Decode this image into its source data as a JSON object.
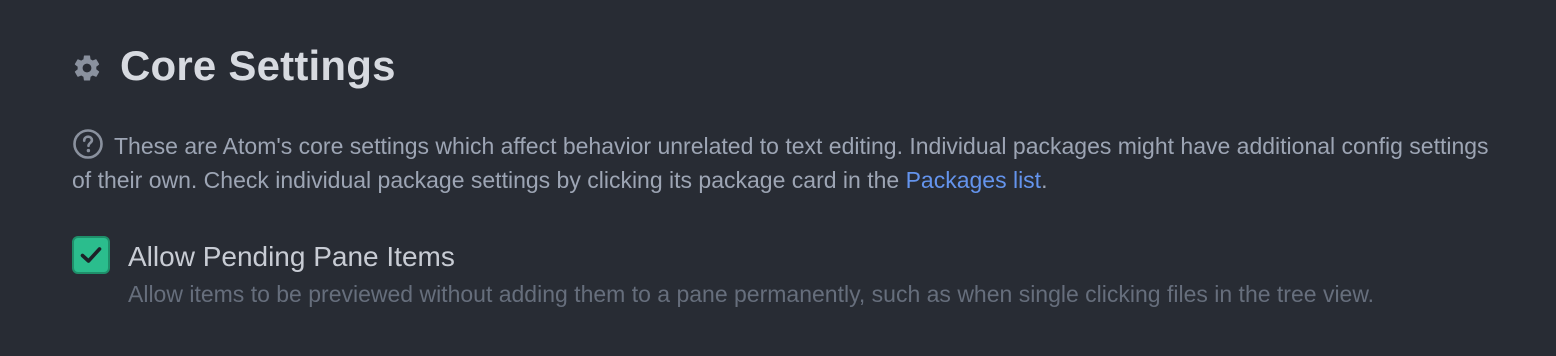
{
  "header": {
    "icon": "gear-icon",
    "title": "Core Settings"
  },
  "description": {
    "icon": "question-circle-icon",
    "text_before_link": "These are Atom's core settings which affect behavior unrelated to text editing. Individual packages might have additional config settings of their own. Check individual package settings by clicking its package card in the ",
    "link_label": "Packages list",
    "text_after_link": "."
  },
  "settings": [
    {
      "title": "Allow Pending Pane Items",
      "checked": true,
      "description": "Allow items to be previewed without adding them to a pane permanently, such as when single clicking files in the tree view."
    }
  ],
  "colors": {
    "background": "#282c34",
    "title": "#d7dae0",
    "text": "#9da5b4",
    "muted": "#666e7c",
    "link": "#6494ed",
    "checkbox": "#2bbd8d"
  }
}
